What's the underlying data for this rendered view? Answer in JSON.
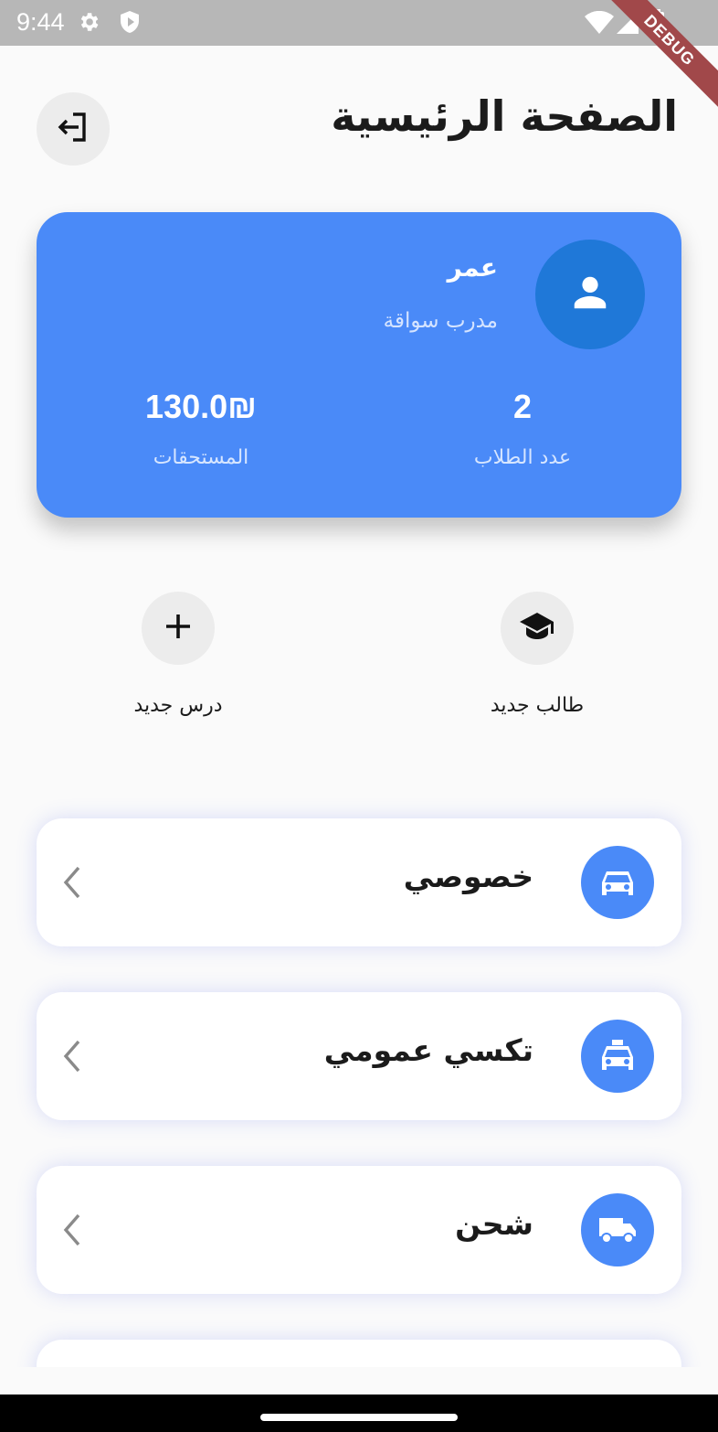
{
  "status_bar": {
    "time": "9:44",
    "debug_label": "DEBUG"
  },
  "header": {
    "title": "الصفحة الرئيسية",
    "logout_icon": "logout-icon"
  },
  "profile": {
    "name": "عمر",
    "role": "مدرب سواقة",
    "avatar_icon": "person-icon",
    "stats": [
      {
        "value": "2",
        "label": "عدد الطلاب"
      },
      {
        "value": "130.0₪",
        "label": "المستحقات"
      }
    ]
  },
  "actions": [
    {
      "label": "طالب جديد",
      "icon": "graduation-cap-icon"
    },
    {
      "label": "درس جديد",
      "icon": "plus-icon"
    }
  ],
  "categories": [
    {
      "label": "خصوصي",
      "icon": "car-icon"
    },
    {
      "label": "تكسي عمومي",
      "icon": "taxi-icon"
    },
    {
      "label": "شحن",
      "icon": "truck-icon"
    }
  ],
  "colors": {
    "primary": "#4a8af8",
    "avatar": "#1f78d8",
    "background": "#fafafa",
    "ribbon": "#a1484a"
  }
}
